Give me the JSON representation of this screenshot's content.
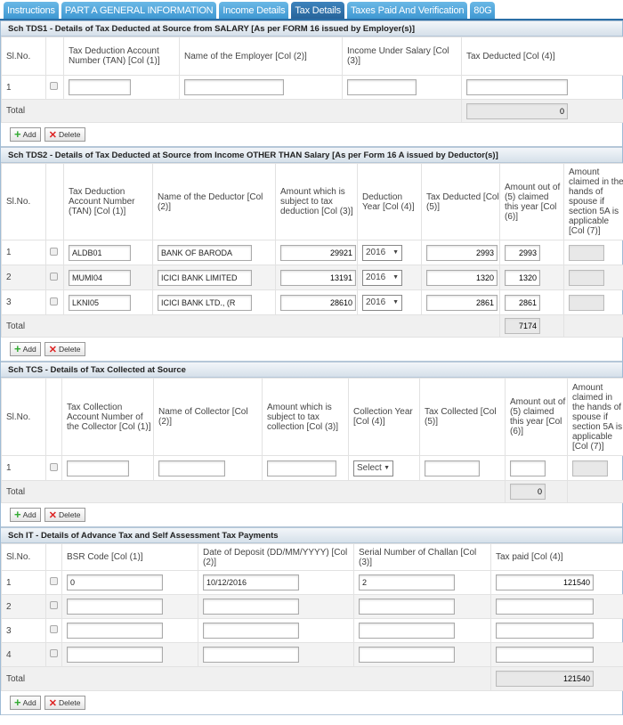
{
  "tabs": [
    {
      "label": "Instructions"
    },
    {
      "label": "PART A GENERAL INFORMATION"
    },
    {
      "label": "Income Details"
    },
    {
      "label": "Tax Details",
      "active": true
    },
    {
      "label": "Taxes Paid And Verification"
    },
    {
      "label": "80G"
    }
  ],
  "buttons": {
    "add": "Add",
    "delete": "Delete"
  },
  "total_label": "Total",
  "sections": [
    {
      "id": "tds1",
      "title": "Sch TDS1 - Details of Tax Deducted at Source from SALARY [As per FORM 16 issued by Employer(s)]",
      "headers": [
        "Sl.No.",
        "",
        "Tax Deduction Account Number (TAN) [Col (1)]",
        "Name of the Employer [Col (2)]",
        "Income Under Salary [Col (3)]",
        "Tax Deducted [Col (4)]"
      ],
      "rows": [
        {
          "sl": "1",
          "cells": [
            "",
            "",
            "",
            ""
          ]
        }
      ],
      "total": {
        "col": 5,
        "value": "0"
      }
    },
    {
      "id": "tds2",
      "title": "Sch TDS2 - Details of Tax Deducted at Source from Income OTHER THAN Salary [As per Form 16 A issued by Deductor(s)]",
      "headers": [
        "Sl.No.",
        "",
        "Tax Deduction Account Number (TAN) [Col (1)]",
        "Name of the Deductor [Col (2)]",
        "Amount which is subject to tax deduction [Col (3)]",
        "Deduction Year [Col (4)]",
        "Tax Deducted [Col (5)]",
        "Amount out of (5) claimed this year [Col (6)]",
        "Amount claimed in the hands of spouse if section 5A is applicable [Col (7)]"
      ],
      "rows": [
        {
          "sl": "1",
          "cells": [
            "ALDB01",
            "BANK OF BARODA",
            "29921",
            "2016",
            "2993",
            "2993",
            ""
          ]
        },
        {
          "sl": "2",
          "cells": [
            "MUMI04",
            "ICICI BANK LIMITED",
            "13191",
            "2016",
            "1320",
            "1320",
            ""
          ]
        },
        {
          "sl": "3",
          "cells": [
            "LKNI05",
            "ICICI BANK LTD., (R",
            "28610",
            "2016",
            "2861",
            "2861",
            ""
          ]
        }
      ],
      "total": {
        "col": 7,
        "value": "7174"
      }
    },
    {
      "id": "tcs",
      "title": "Sch TCS - Details of Tax Collected at Source",
      "headers": [
        "Sl.No.",
        "",
        "Tax Collection Account Number of the Collector [Col (1)]",
        "Name of Collector [Col (2)]",
        "Amount which is subject to tax collection [Col (3)]",
        "Collection Year [Col (4)]",
        "Tax Collected [Col (5)]",
        "Amount out of (5) claimed this year [Col (6)]",
        "Amount claimed in the hands of spouse if section 5A is applicable [Col (7)]"
      ],
      "rows": [
        {
          "sl": "1",
          "cells": [
            "",
            "",
            "",
            "Select",
            "",
            "",
            ""
          ]
        }
      ],
      "total": {
        "col": 7,
        "value": "0"
      }
    },
    {
      "id": "it",
      "title": "Sch IT - Details of Advance Tax and Self Assessment Tax Payments",
      "headers": [
        "Sl.No.",
        "",
        "BSR Code [Col (1)]",
        "Date of Deposit (DD/MM/YYYY) [Col (2)]",
        "Serial Number of Challan [Col (3)]",
        "Tax paid [Col (4)]"
      ],
      "rows": [
        {
          "sl": "1",
          "cells": [
            "0",
            "10/12/2016",
            "2",
            "121540"
          ]
        },
        {
          "sl": "2",
          "cells": [
            "",
            "",
            "",
            ""
          ]
        },
        {
          "sl": "3",
          "cells": [
            "",
            "",
            "",
            ""
          ]
        },
        {
          "sl": "4",
          "cells": [
            "",
            "",
            "",
            ""
          ]
        }
      ],
      "total": {
        "col": 5,
        "value": "121540"
      }
    }
  ]
}
